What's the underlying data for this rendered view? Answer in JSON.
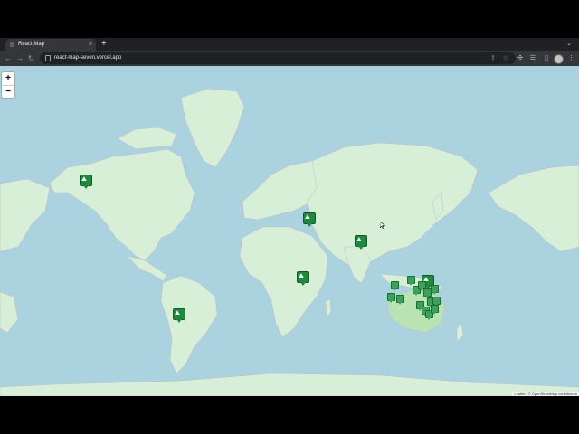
{
  "browser": {
    "tab_title": "React Map",
    "tab_close": "×",
    "new_tab": "+",
    "url": "react-map-seven.vercel.app"
  },
  "map": {
    "zoom_in": "+",
    "zoom_out": "−",
    "attribution": "Leaflet | © OpenStreetMap contributors",
    "colors": {
      "water": "#aad3df",
      "land": "#d7efd6",
      "marker": "#1e8a3c"
    }
  }
}
